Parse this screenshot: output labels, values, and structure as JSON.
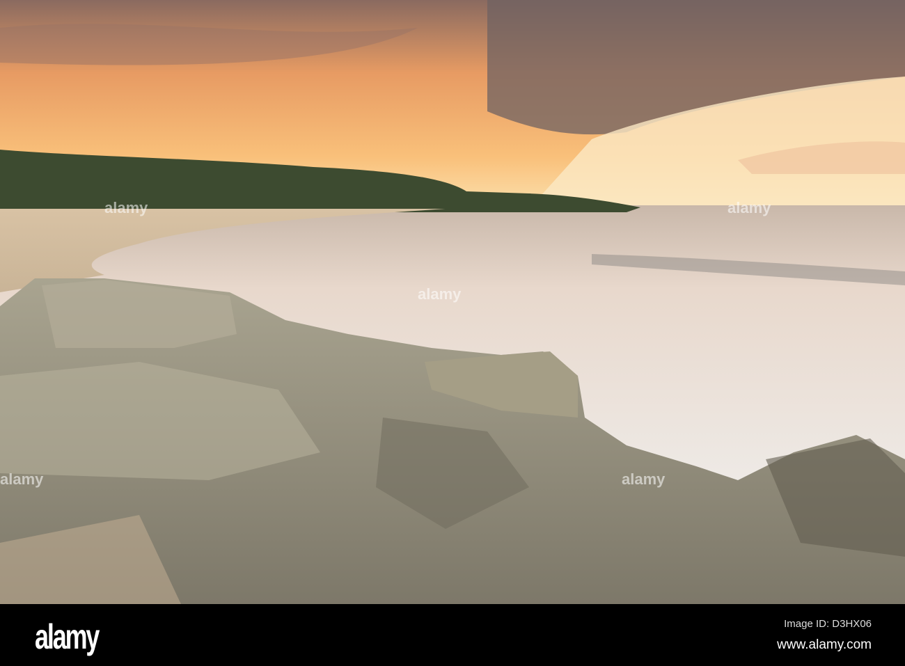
{
  "watermark": {
    "logo": "alamy",
    "image_id": "Image ID: D3HX06",
    "website": "www.alamy.com"
  },
  "colors": {
    "sky_glow": "#fbd9a0",
    "cloud": "#8a6d63",
    "sea": "#d9d0c6",
    "rock": "#9a9584",
    "hill": "#3c4a30"
  }
}
